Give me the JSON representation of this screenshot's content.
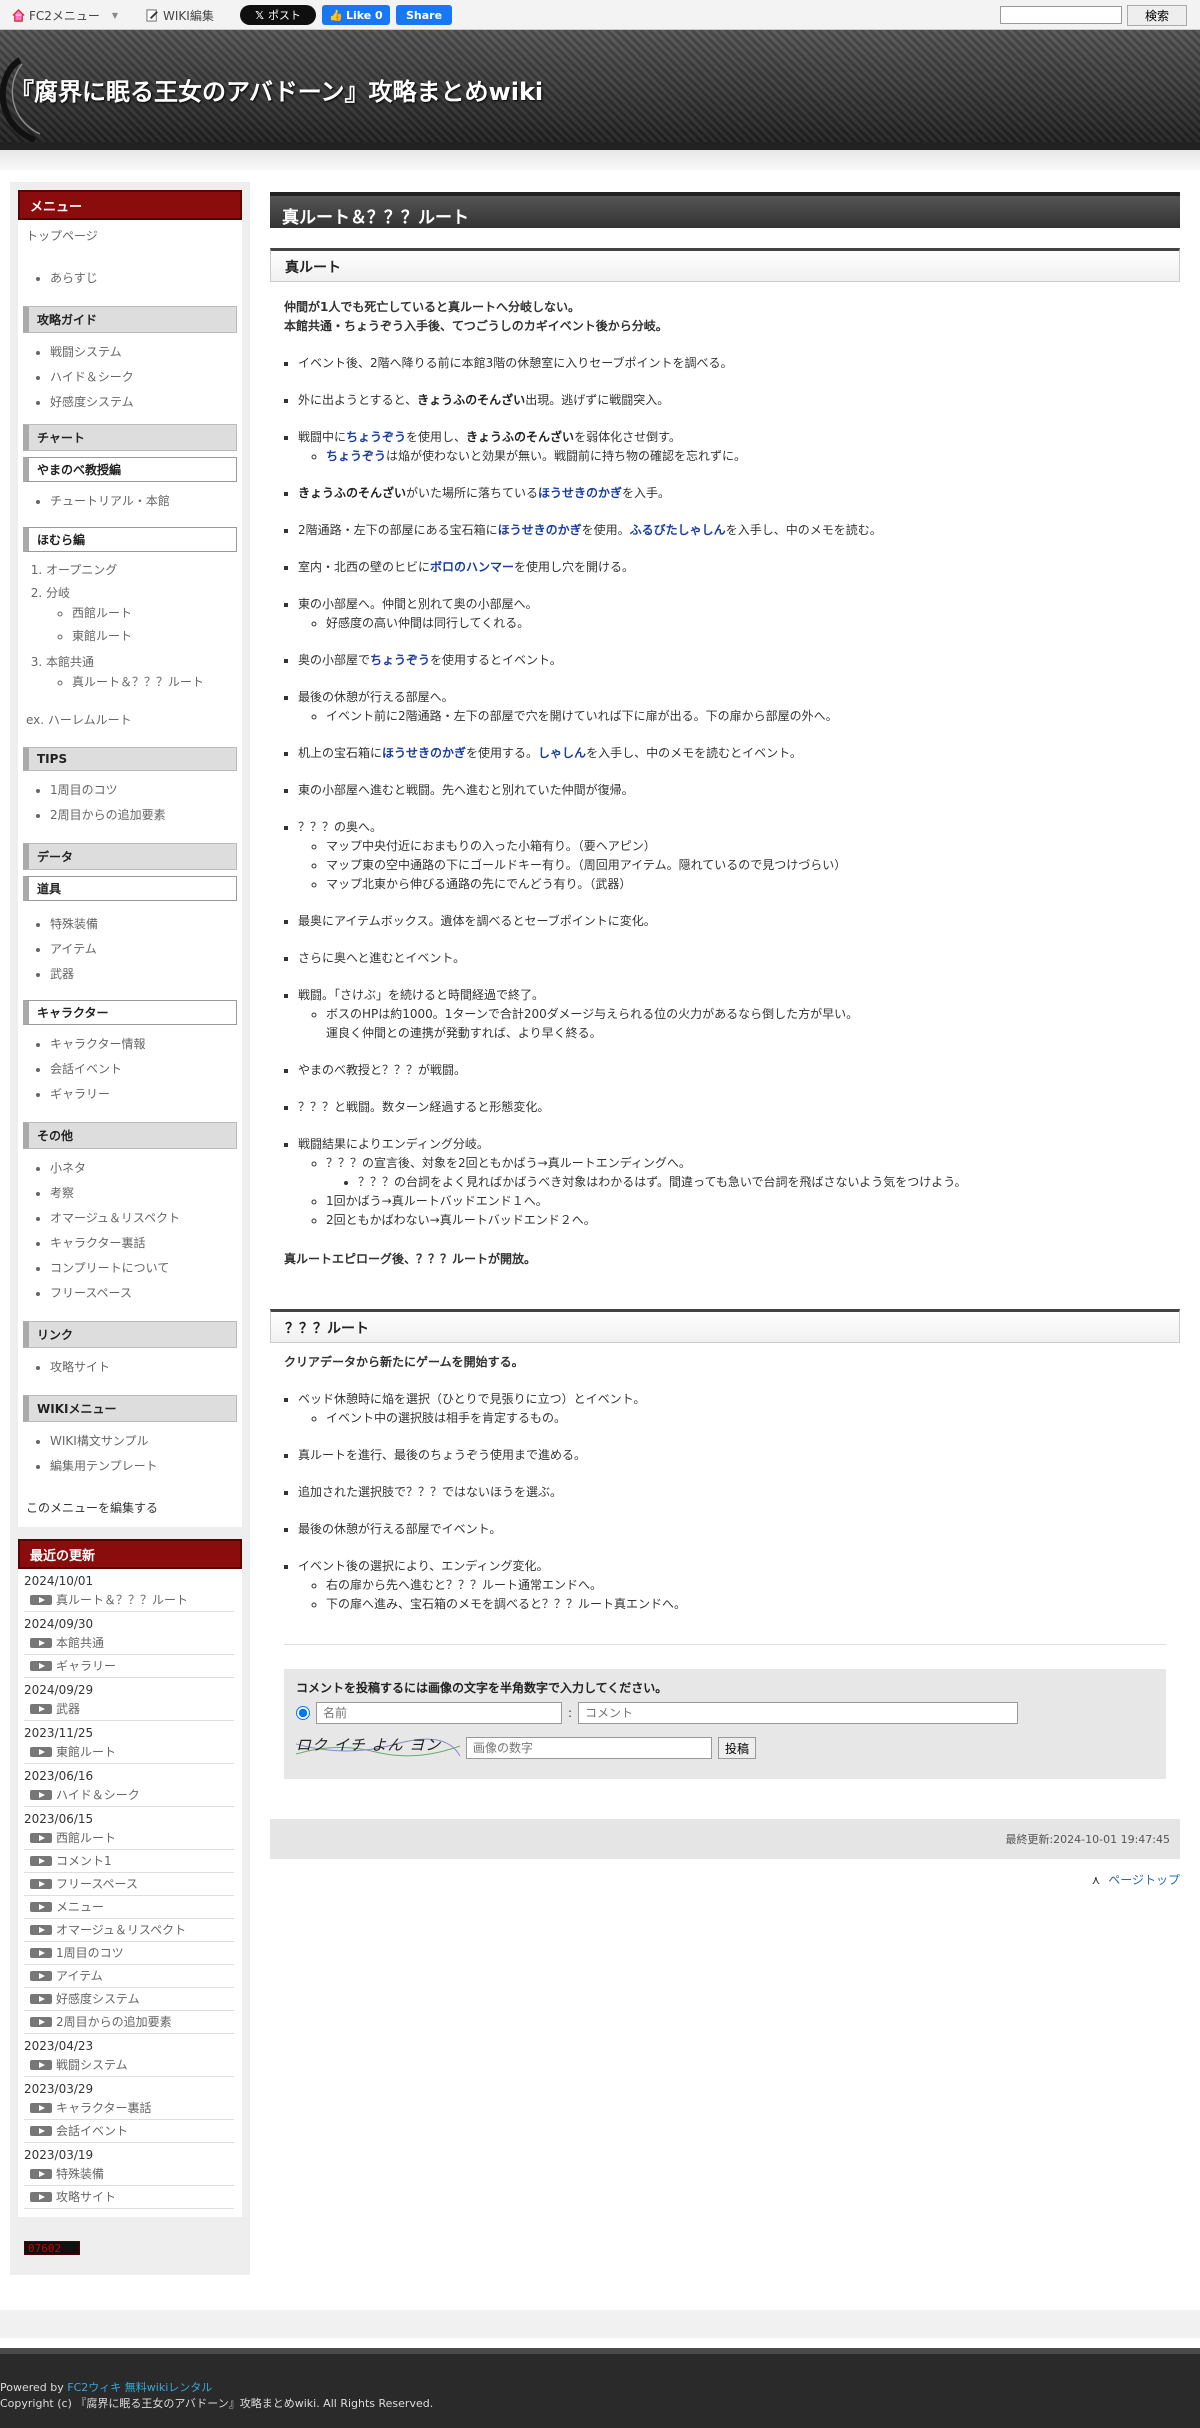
{
  "topbar": {
    "fc2_menu": "FC2メニュー",
    "wiki_edit": "WIKI編集",
    "x_post": "ポスト",
    "fb_like": "Like 0",
    "fb_share": "Share",
    "search_button": "検索"
  },
  "header": {
    "title": "『腐界に眠る王女のアバドーン』攻略まとめwiki"
  },
  "sidebar": {
    "menu_title": "メニュー",
    "top_page": "トップページ",
    "arasuji": "あらすじ",
    "guide_h": "攻略ガイド",
    "guide_items": [
      "戦闘システム",
      "ハイド＆シーク",
      "好感度システム"
    ],
    "chart_h": "チャート",
    "yamanobe_h": "やまのべ教授編",
    "yamanobe_items": [
      "チュートリアル・本館"
    ],
    "homura_h": "ほむら編",
    "homura_1": "オープニング",
    "homura_2": "分岐",
    "homura_2a": "西館ルート",
    "homura_2b": "東館ルート",
    "homura_3": "本館共通",
    "homura_3a": "真ルート＆？？？ルート",
    "ex": "ex. ハーレムルート",
    "tips_h": "TIPS",
    "tips_items": [
      "1周目のコツ",
      "2周目からの追加要素"
    ],
    "data_h": "データ",
    "dougu_h": "道具",
    "dougu_items": [
      "特殊装備",
      "アイテム",
      "武器"
    ],
    "chara_h": "キャラクター",
    "chara_items": [
      "キャラクター情報",
      "会話イベント",
      "ギャラリー"
    ],
    "other_h": "その他",
    "other_items": [
      "小ネタ",
      "考察",
      "オマージュ＆リスペクト",
      "キャラクター裏話",
      "コンプリートについて",
      "フリースペース"
    ],
    "link_h": "リンク",
    "link_items": [
      "攻略サイト"
    ],
    "wikimenu_h": "WIKIメニュー",
    "wikimenu_items": [
      "WIKI構文サンプル",
      "編集用テンプレート"
    ],
    "edit_menu": "このメニューを編集する",
    "updates_title": "最近の更新",
    "updates": [
      {
        "date": "2024/10/01",
        "items": [
          "真ルート＆？？？ルート"
        ]
      },
      {
        "date": "2024/09/30",
        "items": [
          "本館共通",
          "ギャラリー"
        ]
      },
      {
        "date": "2024/09/29",
        "items": [
          "武器"
        ]
      },
      {
        "date": "2023/11/25",
        "items": [
          "東館ルート"
        ]
      },
      {
        "date": "2023/06/16",
        "items": [
          "ハイド＆シーク"
        ]
      },
      {
        "date": "2023/06/15",
        "items": [
          "西館ルート",
          "コメント1",
          "フリースペース",
          "メニュー",
          "オマージュ＆リスペクト",
          "1周目のコツ",
          "アイテム",
          "好感度システム",
          "2周目からの追加要素"
        ]
      },
      {
        "date": "2023/04/23",
        "items": [
          "戦闘システム"
        ]
      },
      {
        "date": "2023/03/29",
        "items": [
          "キャラクター裏話",
          "会話イベント"
        ]
      },
      {
        "date": "2023/03/19",
        "items": [
          "特殊装備",
          "攻略サイト"
        ]
      }
    ],
    "counter": "07602"
  },
  "main": {
    "page_title": "真ルート＆？？？ルート",
    "sec1_title": "真ルート",
    "sec1_intro_1": "仲間が1人でも死亡していると真ルートへ分岐しない。",
    "sec1_intro_2": "本館共通・ちょうぞう入手後、てつごうしのカギイベント後から分岐。",
    "s1": "イベント後、2階へ降りる前に本館3階の休憩室に入りセーブポイントを調べる。",
    "s2a": "外に出ようとすると、",
    "s2b": "きょうふのそんざい",
    "s2c": "出現。逃げずに戦闘突入。",
    "s3a": "戦闘中に",
    "s3b": "ちょうぞう",
    "s3c": "を使用し、",
    "s3d": "きょうふのそんざい",
    "s3e": "を弱体化させ倒す。",
    "s3sub_a": "ちょうぞう",
    "s3sub_b": "は焔が使わないと効果が無い。戦闘前に持ち物の確認を忘れずに。",
    "s4a": "きょうふのそんざい",
    "s4b": "がいた場所に落ちている",
    "s4c": "ほうせきのかぎ",
    "s4d": "を入手。",
    "s5a": "2階通路・左下の部屋にある宝石箱に",
    "s5b": "ほうせきのかぎ",
    "s5c": "を使用。",
    "s5d": "ふるびたしゃしん",
    "s5e": "を入手し、中のメモを読む。",
    "s6a": "室内・北西の壁のヒビに",
    "s6b": "ボロのハンマー",
    "s6c": "を使用し穴を開ける。",
    "s7": "東の小部屋へ。仲間と別れて奥の小部屋へ。",
    "s7sub": "好感度の高い仲間は同行してくれる。",
    "s8a": "奥の小部屋で",
    "s8b": "ちょうぞう",
    "s8c": "を使用するとイベント。",
    "s9": "最後の休憩が行える部屋へ。",
    "s9sub": "イベント前に2階通路・左下の部屋で穴を開けていれば下に扉が出る。下の扉から部屋の外へ。",
    "s10a": "机上の宝石箱に",
    "s10b": "ほうせきのかぎ",
    "s10c": "を使用する。",
    "s10d": "しゃしん",
    "s10e": "を入手し、中のメモを読むとイベント。",
    "s11": "東の小部屋へ進むと戦闘。先へ進むと別れていた仲間が復帰。",
    "s12": "？？？の奥へ。",
    "s12sub": [
      "マップ中央付近におまもりの入った小箱有り。（要ヘアピン）",
      "マップ東の空中通路の下にゴールドキー有り。（周回用アイテム。隠れているので見つけづらい）",
      "マップ北東から伸びる通路の先にでんどう有り。（武器）"
    ],
    "s13": "最奥にアイテムボックス。遺体を調べるとセーブポイントに変化。",
    "s14": "さらに奥へと進むとイベント。",
    "s15": "戦闘。「さけぶ」を続けると時間経過で終了。",
    "s15sub_1": "ボスのHPは約1000。1ターンで合計200ダメージ与えられる位の火力があるなら倒した方が早い。",
    "s15sub_2": "運良く仲間との連携が発動すれば、より早く終る。",
    "s16": "やまのべ教授と？？？が戦闘。",
    "s17": "？？？と戦闘。数ターン経過すると形態変化。",
    "s18": "戦闘結果によりエンディング分岐。",
    "s18sub_1": "？？？の宣言後、対象を2回ともかばう→真ルートエンディングへ。",
    "s18sub_1a": "？？？の台詞をよく見ればかばうべき対象はわかるはず。間違っても急いで台詞を飛ばさないよう気をつけよう。",
    "s18sub_2": "1回かばう→真ルートバッドエンド１へ。",
    "s18sub_3": "2回ともかばわない→真ルートバッドエンド２へ。",
    "sec1_outro": "真ルートエピローグ後、？？？ルートが開放。",
    "sec2_title": "？？？ルート",
    "sec2_intro": "クリアデータから新たにゲームを開始する。",
    "t1": "ベッド休憩時に焔を選択（ひとりで見張りに立つ）とイベント。",
    "t1sub": "イベント中の選択肢は相手を肯定するもの。",
    "t2": "真ルートを進行、最後のちょうぞう使用まで進める。",
    "t3": "追加された選択肢で？？？ではないほうを選ぶ。",
    "t4": "最後の休憩が行える部屋でイベント。",
    "t5": "イベント後の選択により、エンディング変化。",
    "t5sub": [
      "右の扉から先へ進むと？？？ルート通常エンドへ。",
      "下の扉へ進み、宝石箱のメモを調べると？？？ルート真エンドへ。"
    ],
    "comment_head": "コメントを投稿するには画像の文字を半角数字で入力してください。",
    "name_placeholder": "名前",
    "comment_placeholder": "コメント",
    "captcha_text": "ロク イチ よん ヨン",
    "captcha_placeholder": "画像の数字",
    "post_button": "投稿",
    "last_updated": "最終更新:2024-10-01 19:47:45",
    "pagetop": "ページトップ"
  },
  "footer": {
    "powered_by": "Powered by",
    "fc2_link": "FC2ウィキ",
    "rental_link": "無料wikiレンタル",
    "copyright": "Copyright (c) 『腐界に眠る王女のアバドーン』攻略まとめwiki. All Rights Reserved."
  },
  "colors": {
    "accent_red": "#8a0c0c",
    "keyword_blue": "#1a3d9e",
    "link_blue": "#2a6ab0"
  }
}
